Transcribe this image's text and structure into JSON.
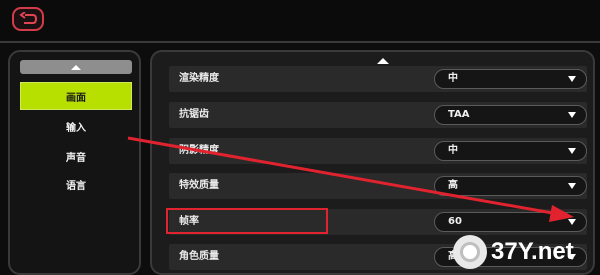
{
  "categories": [
    {
      "label": "画面",
      "active": true
    },
    {
      "label": "输入",
      "active": false
    },
    {
      "label": "声音",
      "active": false
    },
    {
      "label": "语言",
      "active": false
    }
  ],
  "settings": [
    {
      "label": "渲染精度",
      "value": "中"
    },
    {
      "label": "抗锯齿",
      "value": "TAA"
    },
    {
      "label": "阴影精度",
      "value": "中"
    },
    {
      "label": "特效质量",
      "value": "高"
    },
    {
      "label": "帧率",
      "value": "60"
    },
    {
      "label": "角色质量",
      "value": "高"
    }
  ],
  "watermark": {
    "text": "37Y.net"
  },
  "colors": {
    "accent": "#b7e000",
    "highlight": "#e0232e",
    "back_border": "#d23c4a"
  },
  "icons": {
    "back": "back-arrow-icon",
    "scroll_up": "triangle-up-icon",
    "dropdown": "triangle-down-icon"
  }
}
